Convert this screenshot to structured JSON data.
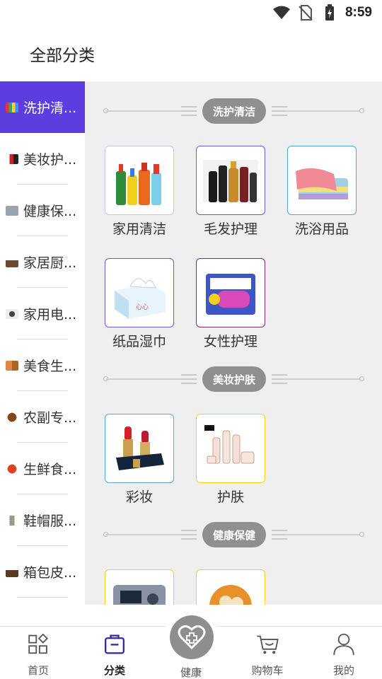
{
  "status_bar": {
    "time": "8:59",
    "icons": [
      "wifi-icon",
      "no-sim-icon",
      "battery-charging-icon"
    ]
  },
  "header": {
    "title": "全部分类"
  },
  "sidebar": {
    "items": [
      {
        "label": "洗护清...",
        "icon": "cleaning-products-thumb",
        "active": true
      },
      {
        "label": "美妆护...",
        "icon": "cosmetics-thumb",
        "active": false
      },
      {
        "label": "健康保...",
        "icon": "health-thumb",
        "active": false
      },
      {
        "label": "家居厨...",
        "icon": "kitchen-thumb",
        "active": false
      },
      {
        "label": "家用电...",
        "icon": "appliance-thumb",
        "active": false
      },
      {
        "label": "美食生...",
        "icon": "food-thumb",
        "active": false
      },
      {
        "label": "农副专...",
        "icon": "farm-thumb",
        "active": false
      },
      {
        "label": "生鲜食...",
        "icon": "fresh-food-thumb",
        "active": false
      },
      {
        "label": "鞋帽服...",
        "icon": "apparel-thumb",
        "active": false
      },
      {
        "label": "箱包皮...",
        "icon": "luggage-thumb",
        "active": false
      }
    ]
  },
  "sections": [
    {
      "title": "洗护清洁",
      "products": [
        {
          "label": "家用清洁",
          "icon": "cleaning-bottles-image"
        },
        {
          "label": "毛发护理",
          "icon": "hair-care-bottles-image"
        },
        {
          "label": "洗浴用品",
          "icon": "towels-image"
        },
        {
          "label": "纸品湿巾",
          "icon": "tissue-box-image"
        },
        {
          "label": "女性护理",
          "icon": "sanitary-pads-image"
        }
      ]
    },
    {
      "title": "美妆护肤",
      "products": [
        {
          "label": "彩妆",
          "icon": "lipstick-image"
        },
        {
          "label": "护肤",
          "icon": "skincare-bottles-image"
        }
      ]
    },
    {
      "title": "健康保健",
      "products": [
        {
          "label": "",
          "icon": "blood-pressure-monitor-image"
        },
        {
          "label": "",
          "icon": "health-food-bowl-image"
        }
      ]
    }
  ],
  "bottom_nav": {
    "items": [
      {
        "label": "首页",
        "icon": "home-grid-icon",
        "active": false
      },
      {
        "label": "分类",
        "icon": "category-bag-icon",
        "active": true
      },
      {
        "label": "健康",
        "icon": "health-heart-plus-icon",
        "active": false
      },
      {
        "label": "购物车",
        "icon": "shopping-cart-icon",
        "active": false
      },
      {
        "label": "我的",
        "icon": "user-profile-icon",
        "active": false
      }
    ]
  },
  "colors": {
    "accent": "#5b3de0",
    "pill": "#8f8f8f",
    "content_bg": "#efefef"
  }
}
